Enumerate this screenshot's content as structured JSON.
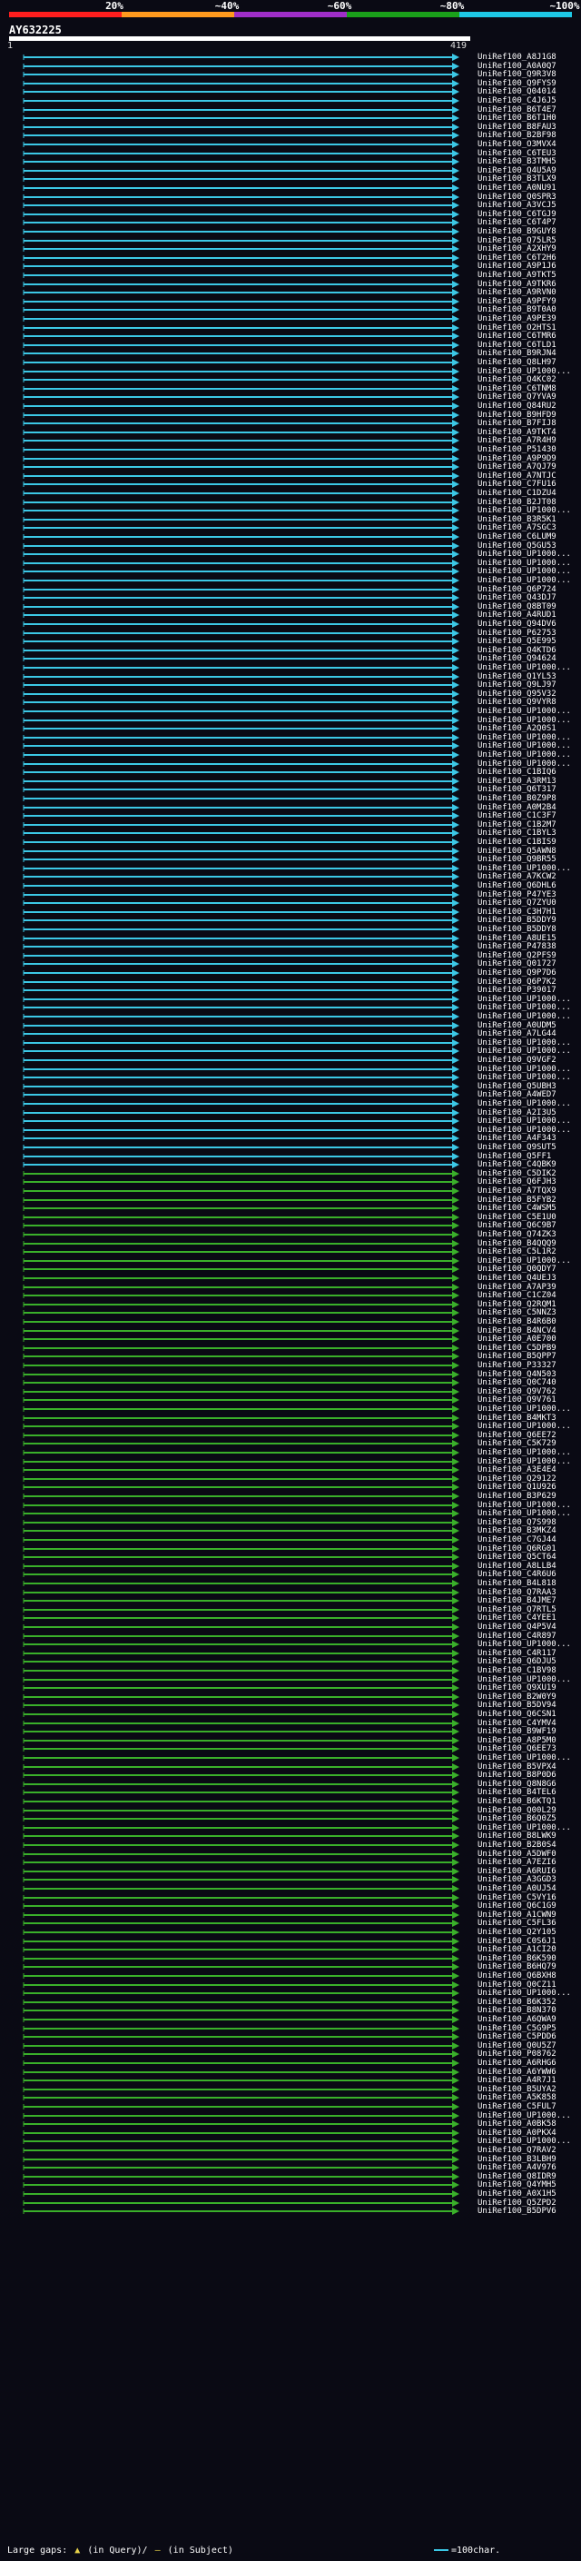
{
  "legend": {
    "labels": [
      "20%",
      "~40%",
      "~60%",
      "~80%",
      "~100%"
    ],
    "colors": [
      "#ff1e1e",
      "#ff9a1e",
      "#a02ec8",
      "#1aa01a",
      "#1ec8e6"
    ]
  },
  "query": {
    "name": "AY632225",
    "start": "1",
    "end": "419"
  },
  "hits": [
    "UniRef100_A8J1G8",
    "UniRef100_A0A0Q7",
    "UniRef100_Q9R3V8",
    "UniRef100_Q9FYS9",
    "UniRef100_Q04014",
    "UniRef100_C4J6J5",
    "UniRef100_B6T4E7",
    "UniRef100_B6T1H0",
    "UniRef100_B8FAU3",
    "UniRef100_B2BF98",
    "UniRef100_O3MVX4",
    "UniRef100_C6TEU3",
    "UniRef100_B3TMH5",
    "UniRef100_Q4U5A9",
    "UniRef100_B3TLX9",
    "UniRef100_A0NU91",
    "UniRef100_Q0SPR3",
    "UniRef100_A3VCJ5",
    "UniRef100_C6TGJ9",
    "UniRef100_C6T4P7",
    "UniRef100_B9GUY8",
    "UniRef100_Q75LR5",
    "UniRef100_A2XHY9",
    "UniRef100_C6T2H6",
    "UniRef100_A9P1J6",
    "UniRef100_A9TKT5",
    "UniRef100_A9TKR6",
    "UniRef100_A9RVN0",
    "UniRef100_A9PFY9",
    "UniRef100_B9T0A0",
    "UniRef100_A9PE39",
    "UniRef100_O2HTS1",
    "UniRef100_C6TMR6",
    "UniRef100_C6TLD1",
    "UniRef100_B9RJN4",
    "UniRef100_Q8LH97",
    "UniRef100_UP1000...",
    "UniRef100_Q4KC02",
    "UniRef100_C6TNM8",
    "UniRef100_Q7YVA9",
    "UniRef100_Q84RU2",
    "UniRef100_B9HFD9",
    "UniRef100_B7FIJ8",
    "UniRef100_A9TKT4",
    "UniRef100_A7R4H9",
    "UniRef100_P51430",
    "UniRef100_A9P9D9",
    "UniRef100_A7QJ79",
    "UniRef100_A7NTJC",
    "UniRef100_C7FU16",
    "UniRef100_C1DZU4",
    "UniRef100_B2JT08",
    "UniRef100_UP1000...",
    "UniRef100_B3R5K1",
    "UniRef100_A7SGC3",
    "UniRef100_C6LUM9",
    "UniRef100_Q5GU53",
    "UniRef100_UP1000...",
    "UniRef100_UP1000...",
    "UniRef100_UP1000...",
    "UniRef100_UP1000...",
    "UniRef100_Q6P724",
    "UniRef100_Q43DJ7",
    "UniRef100_Q8BT09",
    "UniRef100_A4RUD1",
    "UniRef100_Q94DV6",
    "UniRef100_P62753",
    "UniRef100_Q5E995",
    "UniRef100_Q4KTD6",
    "UniRef100_Q94624",
    "UniRef100_UP1000...",
    "UniRef100_Q1YL53",
    "UniRef100_Q9LJ97",
    "UniRef100_Q95V32",
    "UniRef100_Q9VYR8",
    "UniRef100_UP1000...",
    "UniRef100_UP1000...",
    "UniRef100_A2Q0S1",
    "UniRef100_UP1000...",
    "UniRef100_UP1000...",
    "UniRef100_UP1000...",
    "UniRef100_UP1000...",
    "UniRef100_C1BIQ6",
    "UniRef100_A3RM13",
    "UniRef100_Q6T317",
    "UniRef100_B0Z9P8",
    "UniRef100_A0M2B4",
    "UniRef100_C1C3F7",
    "UniRef100_C1B2M7",
    "UniRef100_C1BYL3",
    "UniRef100_C1BIS9",
    "UniRef100_Q5AWN8",
    "UniRef100_Q9BR55",
    "UniRef100_UP1000...",
    "UniRef100_A7KCW2",
    "UniRef100_Q6DHL6",
    "UniRef100_P47YE3",
    "UniRef100_Q7ZYU0",
    "UniRef100_C3H7H1",
    "UniRef100_B5DDY9",
    "UniRef100_B5DDY8",
    "UniRef100_A8UE15",
    "UniRef100_P47838",
    "UniRef100_Q2PFS9",
    "UniRef100_Q01727",
    "UniRef100_Q9P7D6",
    "UniRef100_Q6P7K2",
    "UniRef100_P39017",
    "UniRef100_UP1000...",
    "UniRef100_UP1000...",
    "UniRef100_UP1000...",
    "UniRef100_A0UDM5",
    "UniRef100_A7LG44",
    "UniRef100_UP1000...",
    "UniRef100_UP1000...",
    "UniRef100_Q9VGF2",
    "UniRef100_UP1000...",
    "UniRef100_UP1000...",
    "UniRef100_Q5UBH3",
    "UniRef100_A4WED7",
    "UniRef100_UP1000...",
    "UniRef100_A2I3U5",
    "UniRef100_UP1000...",
    "UniRef100_UP1000...",
    "UniRef100_A4F343",
    "UniRef100_Q9SUT5",
    "UniRef100_Q5FF1",
    "UniRef100_C4QBK9",
    "UniRef100_C5DIK2",
    "UniRef100_Q6FJH3",
    "UniRef100_A7TQX9",
    "UniRef100_B5FYB2",
    "UniRef100_C4WSM5",
    "UniRef100_C5E1U0",
    "UniRef100_Q6C9B7",
    "UniRef100_Q74ZK3",
    "UniRef100_B4QQQ9",
    "UniRef100_C5L1R2",
    "UniRef100_UP1000...",
    "UniRef100_Q0QDY7",
    "UniRef100_Q4UEJ3",
    "UniRef100_A7AP39",
    "UniRef100_C1CZ04",
    "UniRef100_Q2RQM1",
    "UniRef100_C5NNZ3",
    "UniRef100_B4R6B0",
    "UniRef100_B4NCV4",
    "UniRef100_A0E700",
    "UniRef100_C5DPB9",
    "UniRef100_B5QPP7",
    "UniRef100_P33327",
    "UniRef100_Q4N503",
    "UniRef100_Q0C740",
    "UniRef100_Q9V762",
    "UniRef100_Q9V761",
    "UniRef100_UP1000...",
    "UniRef100_B4MKT3",
    "UniRef100_UP1000...",
    "UniRef100_Q6EE72",
    "UniRef100_C5K729",
    "UniRef100_UP1000...",
    "UniRef100_UP1000...",
    "UniRef100_A3E4E4",
    "UniRef100_Q29122",
    "UniRef100_Q1U926",
    "UniRef100_B3P629",
    "UniRef100_UP1000...",
    "UniRef100_UP1000...",
    "UniRef100_Q7S998",
    "UniRef100_B3MKZ4",
    "UniRef100_C7GJ44",
    "UniRef100_Q6RG01",
    "UniRef100_Q5CT64",
    "UniRef100_A8LLB4",
    "UniRef100_C4R6U6",
    "UniRef100_B4L818",
    "UniRef100_Q7RAA3",
    "UniRef100_B4JME7",
    "UniRef100_Q7RTL5",
    "UniRef100_C4YEE1",
    "UniRef100_Q4P5V4",
    "UniRef100_C4R897",
    "UniRef100_UP1000...",
    "UniRef100_C4R117",
    "UniRef100_Q6DJU5",
    "UniRef100_C1BV98",
    "UniRef100_UP1000...",
    "UniRef100_Q9XU19",
    "UniRef100_B2W0Y9",
    "UniRef100_B5DV94",
    "UniRef100_Q6CSN1",
    "UniRef100_C4YMV4",
    "UniRef100_B9WF19",
    "UniRef100_A8P5M0",
    "UniRef100_Q6EE73",
    "UniRef100_UP1000...",
    "UniRef100_B5VPX4",
    "UniRef100_B8P0D6",
    "UniRef100_Q8N8G6",
    "UniRef100_B4TEL6",
    "UniRef100_B6KTQ1",
    "UniRef100_Q00L29",
    "UniRef100_B6Q0Z5",
    "UniRef100_UP1000...",
    "UniRef100_B8LWK9",
    "UniRef100_B2B0S4",
    "UniRef100_A5DWF0",
    "UniRef100_A7EZI6",
    "UniRef100_A6RUI6",
    "UniRef100_A3GGD3",
    "UniRef100_A0UJ54",
    "UniRef100_C5VY16",
    "UniRef100_Q6C1G9",
    "UniRef100_A1CWN9",
    "UniRef100_C5FL36",
    "UniRef100_Q2Y105",
    "UniRef100_C0S6J1",
    "UniRef100_A1CI20",
    "UniRef100_B6K590",
    "UniRef100_B6HQ79",
    "UniRef100_Q6BXH8",
    "UniRef100_Q0CZ11",
    "UniRef100_UP1000...",
    "UniRef100_B6K352",
    "UniRef100_B8N370",
    "UniRef100_A6QWA9",
    "UniRef100_C5G9P5",
    "UniRef100_C5PDD6",
    "UniRef100_Q0U5Z7",
    "UniRef100_P08762",
    "UniRef100_A6RHG6",
    "UniRef100_A6YWW6",
    "UniRef100_A4R7J1",
    "UniRef100_B5UYA2",
    "UniRef100_A5K858",
    "UniRef100_C5FUL7",
    "UniRef100_UP1000...",
    "UniRef100_A0BK58",
    "UniRef100_A0PKX4",
    "UniRef100_UP1000...",
    "UniRef100_Q7RAV2",
    "UniRef100_B3LBH9",
    "UniRef100_A4V976",
    "UniRef100_Q8IDR9",
    "UniRef100_Q4YMH5",
    "UniRef100_A0X1H5",
    "UniRef100_Q5ZPD2",
    "UniRef100_B5DPV6"
  ],
  "footer": {
    "large_gaps_label": "Large gaps:",
    "in_query": "(in Query)/",
    "in_subject": "(in Subject)",
    "scale_label": "=100char."
  }
}
